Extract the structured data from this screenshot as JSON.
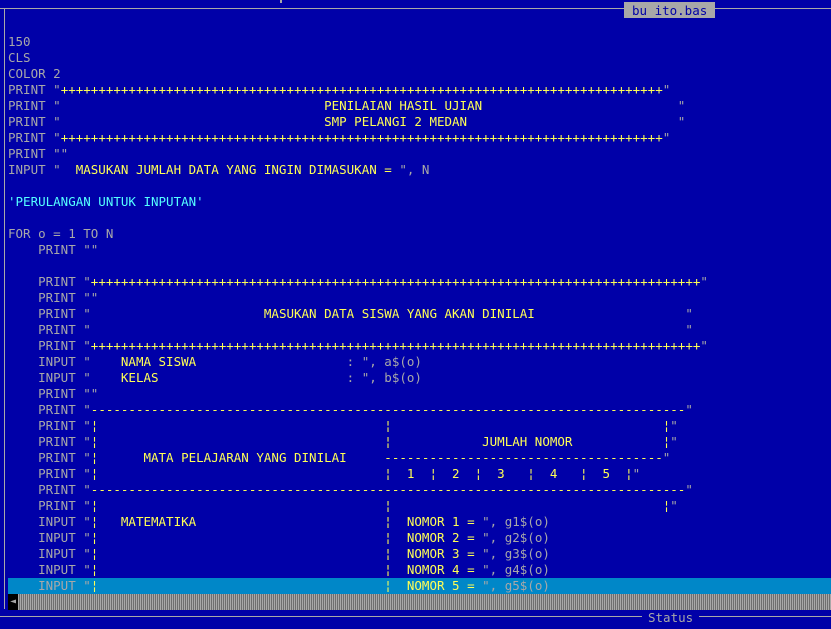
{
  "window": {
    "title": "bu ito.bas",
    "status_label": "Status"
  },
  "colors": {
    "background": "#0000a8",
    "text": "#a8a8a8",
    "string": "#ffff55",
    "comment": "#55ffff",
    "current_line": "#0087c8"
  },
  "code": {
    "l01": "150",
    "l02": "CLS",
    "l03": "COLOR 2",
    "l04a": "PRINT \"",
    "l04b": "++++++++++++++++++++++++++++++++++++++++++++++++++++++++++++++++++++++++++++++++",
    "l04c": "\"",
    "l05a": "PRINT \"",
    "l05b": "                                   PENILAIAN HASIL UJIAN",
    "l05c": "                          \"",
    "l06a": "PRINT \"",
    "l06b": "                                   SMP PELANGI 2 MEDAN",
    "l06c": "                            \"",
    "l07a": "PRINT \"",
    "l07b": "++++++++++++++++++++++++++++++++++++++++++++++++++++++++++++++++++++++++++++++++",
    "l07c": "\"",
    "l08": "PRINT \"\"",
    "l09a": "INPUT \"  ",
    "l09b": "MASUKAN JUMLAH DATA YANG INGIN DIMASUKAN = ",
    "l09c": "\", N",
    "l10": "'PERULANGAN UNTUK INPUTAN'",
    "l11": "FOR o = 1 TO N",
    "l12": "    PRINT \"\"",
    "l13a": "    PRINT \"",
    "l13b": "+++++++++++++++++++++++++++++++++++++++++++++++++++++++++++++++++++++++++++++++++",
    "l13c": "\"",
    "l14": "    PRINT \"\"",
    "l15a": "    PRINT \"",
    "l15b": "                       MASUKAN DATA SISWA YANG AKAN DINILAI",
    "l15c": "                    \"",
    "l16a": "    PRINT \"",
    "l16c": "                                                                               \"",
    "l17a": "    PRINT \"",
    "l17b": "+++++++++++++++++++++++++++++++++++++++++++++++++++++++++++++++++++++++++++++++++",
    "l17c": "\"",
    "l18a": "    INPUT \"",
    "l18b": "    NAMA SISWA",
    "l18c": "                    : \", a$(o)",
    "l19a": "    INPUT \"",
    "l19b": "    KELAS",
    "l19c": "                         : \", b$(o)",
    "l20": "    PRINT \"\"",
    "l21a": "    PRINT \"",
    "l21b": "-------------------------------------------------------------------------------",
    "l21c": "\"",
    "l22a": "    PRINT \"",
    "l22b": "¦                                      ¦                                    ¦",
    "l22c": "\"",
    "l23a": "    PRINT \"",
    "l23b": "¦                                      ¦            JUMLAH NOMOR            ¦",
    "l23c": "\"",
    "l24a": "    PRINT \"",
    "l24b": "¦      MATA PELAJARAN YANG DINILAI     -------------------------------------",
    "l24c": "\"",
    "l25a": "    PRINT \"",
    "l25b": "¦                                      ¦  1  ¦  2  ¦  3   ¦  4   ¦  5  ¦",
    "l25c": "\"",
    "l26a": "    PRINT \"",
    "l26b": "-------------------------------------------------------------------------------",
    "l26c": "\"",
    "l27a": "    PRINT \"",
    "l27b": "¦                                      ¦                                    ¦",
    "l27c": "\"",
    "l28a": "    INPUT \"",
    "l28b": "¦   MATEMATIKA                         ¦  NOMOR 1 = ",
    "l28c": "\", g1$(o)",
    "l29a": "    INPUT \"",
    "l29b": "¦                                      ¦  NOMOR 2 = ",
    "l29c": "\", g2$(o)",
    "l30a": "    INPUT \"",
    "l30b": "¦                                      ¦  NOMOR 3 = ",
    "l30c": "\", g3$(o)",
    "l31a": "    INPUT \"",
    "l31b": "¦                                      ¦  NOMOR 4 = ",
    "l31c": "\", g4$(o)",
    "l32a": "    INPUT \"",
    "l32b": "¦                                      ¦  NOMOR 5 = ",
    "l32c": "\", g5$(o)"
  },
  "scrollbar": {
    "left_arrow": "◄"
  }
}
